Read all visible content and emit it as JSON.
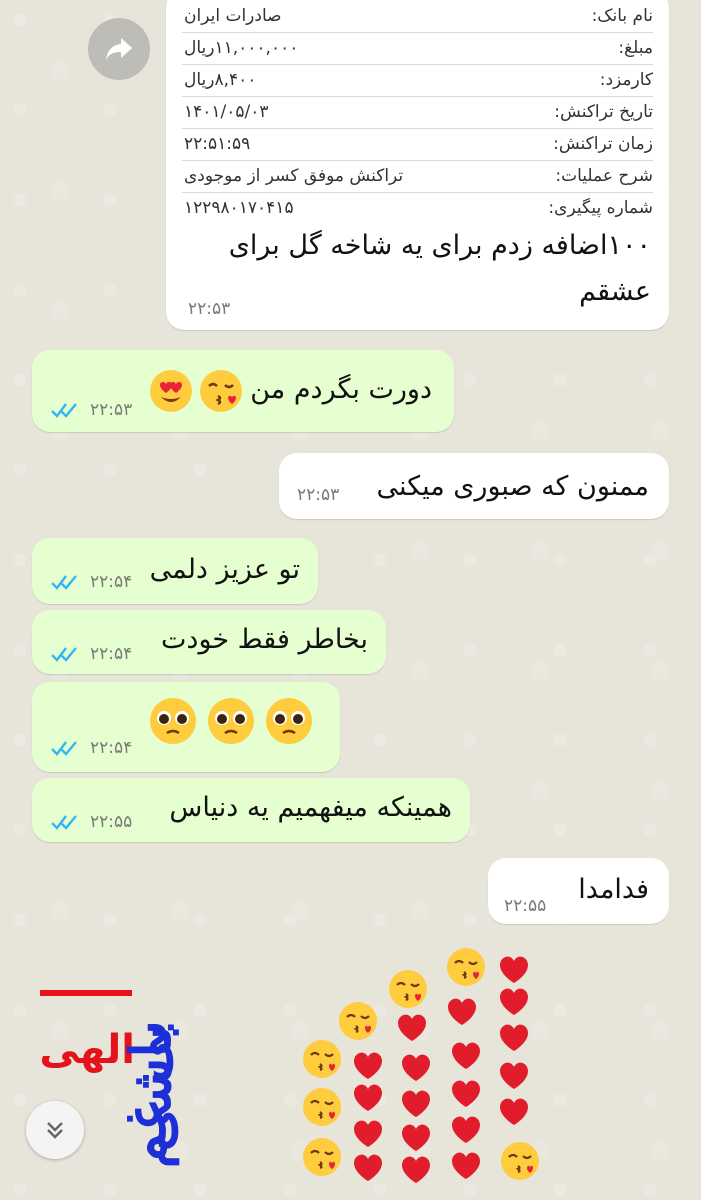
{
  "receipt": {
    "rows": [
      {
        "label": "نام بانک:",
        "value": "صادرات ایران"
      },
      {
        "label": "مبلغ:",
        "value": "۱۱,۰۰۰,۰۰۰ریال"
      },
      {
        "label": "کارمزد:",
        "value": "۸,۴۰۰ریال"
      },
      {
        "label": "تاریخ تراکنش:",
        "value": "۱۴۰۱/۰۵/۰۳"
      },
      {
        "label": "زمان تراکنش:",
        "value": "۲۲:۵۱:۵۹"
      },
      {
        "label": "شرح عملیات:",
        "value": "تراکنش موفق کسر از موجودی"
      },
      {
        "label": "شماره پیگیری:",
        "value": "۱۲۲۹۸۰۱۷۰۴۱۵"
      }
    ],
    "caption_line1": "۱۰۰اضافه زدم برای یه شاخه گل برای",
    "caption_line2": "عشقم",
    "time": "۲۲:۵۳"
  },
  "messages": [
    {
      "id": "m1",
      "direction": "outgoing",
      "text": "دورت بگردم من",
      "emoji": [
        "kiss-heart",
        "heart-eyes"
      ],
      "time": "۲۲:۵۳"
    },
    {
      "id": "m2",
      "direction": "incoming",
      "text": "ممنون که صبوری میکنی",
      "time": "۲۲:۵۳"
    },
    {
      "id": "m3",
      "direction": "outgoing",
      "text": "تو عزیز دلمی",
      "time": "۲۲:۵۴"
    },
    {
      "id": "m4",
      "direction": "outgoing",
      "text": "بخاطر فقط خودت",
      "time": "۲۲:۵۴"
    },
    {
      "id": "m5",
      "direction": "outgoing",
      "text": "",
      "emoji": [
        "pleading",
        "pleading",
        "pleading"
      ],
      "time": "۲۲:۵۴"
    },
    {
      "id": "m6",
      "direction": "outgoing",
      "text": "همینکه میفهمیم یه دنیاس",
      "time": "۲۲:۵۵"
    },
    {
      "id": "m7",
      "direction": "incoming",
      "text": "فدامدا",
      "time": "۲۲:۵۵"
    }
  ],
  "sticker": {
    "line1": "بی غم",
    "line2": "باشی",
    "accent": "الهی",
    "accent_color": "#e3121b",
    "text_color": "#1d2fd6"
  },
  "icons": {
    "forward": "forward-arrow-icon",
    "read_receipt": "double-check-icon",
    "scroll_down": "double-chevron-down-icon"
  },
  "colors": {
    "incoming_bubble": "#ffffff",
    "outgoing_bubble": "#e6ffd0",
    "read_tick": "#34b7f1"
  }
}
